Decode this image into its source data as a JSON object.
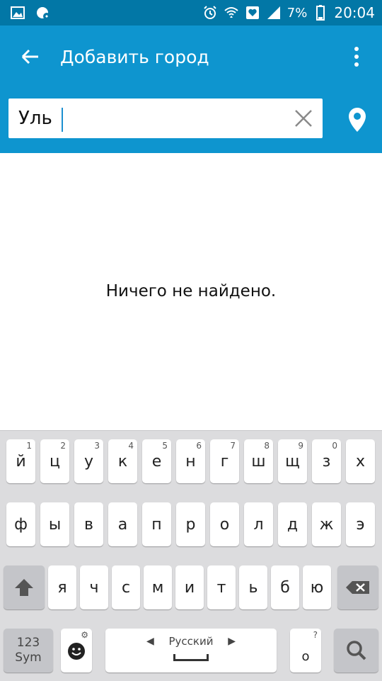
{
  "status_bar": {
    "battery_percent": "7%",
    "time": "20:04",
    "icons": [
      "gallery-icon",
      "weather-update-icon",
      "alarm-icon",
      "wifi-icon",
      "heart-icon",
      "signal-icon",
      "battery-icon"
    ]
  },
  "toolbar": {
    "title": "Добавить город"
  },
  "search": {
    "value": "Уль"
  },
  "content": {
    "empty_message": "Ничего не найдено."
  },
  "keyboard": {
    "row1": [
      {
        "char": "й",
        "hint": "1"
      },
      {
        "char": "ц",
        "hint": "2"
      },
      {
        "char": "у",
        "hint": "3"
      },
      {
        "char": "к",
        "hint": "4"
      },
      {
        "char": "е",
        "hint": "5"
      },
      {
        "char": "н",
        "hint": "6"
      },
      {
        "char": "г",
        "hint": "7"
      },
      {
        "char": "ш",
        "hint": "8"
      },
      {
        "char": "щ",
        "hint": "9"
      },
      {
        "char": "з",
        "hint": "0"
      },
      {
        "char": "х",
        "hint": ""
      }
    ],
    "row2": [
      "ф",
      "ы",
      "в",
      "а",
      "п",
      "р",
      "о",
      "л",
      "д",
      "ж",
      "э"
    ],
    "row3": [
      "я",
      "ч",
      "с",
      "м",
      "и",
      "т",
      "ь",
      "б",
      "ю"
    ],
    "sym_label_top": "123",
    "sym_label_bottom": "Sym",
    "language": "Русский",
    "period": "o",
    "period_hint": "?"
  },
  "colors": {
    "status_bar": "#0277a6",
    "toolbar": "#0e95cf",
    "keyboard_bg": "#dcdcde"
  }
}
